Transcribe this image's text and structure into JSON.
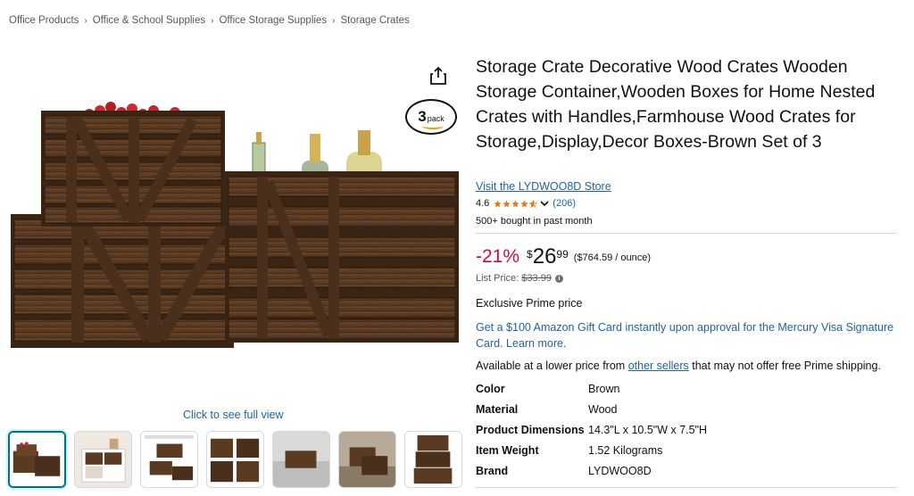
{
  "breadcrumb": {
    "items": [
      "Office Products",
      "Office & School Supplies",
      "Office Storage Supplies",
      "Storage Crates"
    ],
    "separator": "›"
  },
  "gallery": {
    "badge_number": "3",
    "badge_word": "pack",
    "full_view_label": "Click to see full view",
    "thumbnail_count": 7,
    "selected_thumbnail": 0
  },
  "product": {
    "title": "Storage Crate Decorative Wood Crates Wooden Storage Container,Wooden Boxes for Home Nested Crates with Handles,Farmhouse Wood Crates for Storage,Display,Decor Boxes-Brown Set of 3",
    "store_link": "Visit the LYDWOO8D Store",
    "rating": "4.6",
    "rating_stars": 4.6,
    "review_count": "(206)",
    "bought": "500+ bought in past month"
  },
  "pricing": {
    "discount": "-21%",
    "currency": "$",
    "whole": "26",
    "fraction": "99",
    "unit_price": "($764.59 / ounce)",
    "list_price_label": "List Price:",
    "list_price": "$33.99",
    "prime": "Exclusive Prime price",
    "promo": "Get a $100 Amazon Gift Card instantly upon approval for the Mercury Visa Signature Card. Learn more.",
    "avail_prefix": "Available at a lower price from ",
    "avail_link": "other sellers",
    "avail_suffix": " that may not offer free Prime shipping."
  },
  "specs": [
    {
      "key": "Color",
      "value": "Brown"
    },
    {
      "key": "Material",
      "value": "Wood"
    },
    {
      "key": "Product Dimensions",
      "value": "14.3\"L x 10.5\"W x 7.5\"H"
    },
    {
      "key": "Item Weight",
      "value": "1.52 Kilograms"
    },
    {
      "key": "Brand",
      "value": "LYDWOO8D"
    }
  ],
  "colors": {
    "link": "#2162a1",
    "discount": "#cc0c39",
    "star": "#de7921",
    "wood_dark": "#4a2f1c",
    "wood_light": "#7a5538"
  }
}
